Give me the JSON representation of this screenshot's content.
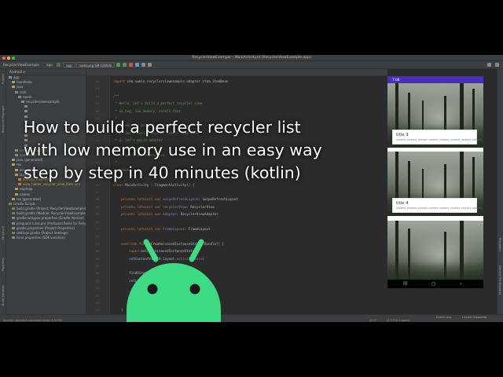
{
  "window": {
    "title": "RecyclerViewExample – MainActivity.kt [RecyclerViewExample.app]"
  },
  "toolbar": {
    "breadcrumbs": [
      "RecyclerViewExample",
      "app",
      "src",
      "main",
      "java",
      "com",
      "swein",
      "recyclerviewexample",
      "MainActivity"
    ],
    "run_config": "app",
    "device": "samsung SM-G991N"
  },
  "tabs": [
    {
      "label": "activity_main.xml",
      "active": false
    },
    {
      "label": "build.gradle (:app)",
      "active": false
    },
    {
      "label": "MainActivity.kt",
      "active": true
    },
    {
      "label": "build.gradle",
      "active": false
    },
    {
      "label": "RecyclerView.kt",
      "active": false
    },
    {
      "label": "FooterViewHolder.kt",
      "active": false
    },
    {
      "label": "RecyclerViewAdapter.kt",
      "active": false
    },
    {
      "label": "ItemBean.kt",
      "active": false
    },
    {
      "label": "MainViewModel.kt",
      "active": false
    }
  ],
  "project": {
    "header": "Android",
    "tree": [
      {
        "label": "app",
        "depth": 0,
        "color": "#a9b7c6",
        "icon": "#6897bb"
      },
      {
        "label": "manifests",
        "depth": 1,
        "color": "#a9b7c6",
        "icon": "#b0a060"
      },
      {
        "label": "java",
        "depth": 1,
        "color": "#a9b7c6",
        "icon": "#b0a060"
      },
      {
        "label": "com",
        "depth": 2,
        "color": "#a9b7c6",
        "icon": "#8a8a8a"
      },
      {
        "label": "swein",
        "depth": 3,
        "color": "#a9b7c6",
        "icon": "#8a8a8a"
      },
      {
        "label": "recyclerviewexample",
        "depth": 4,
        "color": "#a9b7c6",
        "icon": "#8a8a8a"
      },
      {
        "label": "",
        "depth": 5,
        "color": "#a9b7c6",
        "icon": "#8a8a8a"
      },
      {
        "label": "",
        "depth": 5,
        "color": "#a9b7c6",
        "icon": "#8a8a8a"
      },
      {
        "label": "",
        "depth": 5,
        "color": "#a9b7c6",
        "icon": "#8a8a8a"
      },
      {
        "label": "",
        "depth": 5,
        "color": "#a9b7c6",
        "icon": "#8a8a8a"
      },
      {
        "label": "",
        "depth": 5,
        "color": "#a9b7c6",
        "icon": "#8a8a8a"
      },
      {
        "label": "",
        "depth": 5,
        "color": "#a9b7c6",
        "icon": "#8a8a8a"
      },
      {
        "label": "",
        "depth": 5,
        "color": "#a9b7c6",
        "icon": "#8a8a8a"
      },
      {
        "label": "",
        "depth": 5,
        "color": "#a9b7c6",
        "icon": "#8a8a8a"
      },
      {
        "label": "",
        "depth": 5,
        "color": "#a9b7c6",
        "icon": "#8a8a8a"
      },
      {
        "label": "com (androidTest)",
        "depth": 2,
        "color": "#8aa06a",
        "icon": "#8a8a8a"
      },
      {
        "label": "com (test)",
        "depth": 2,
        "color": "#8aa06a",
        "icon": "#8a8a8a"
      },
      {
        "label": "java (generated)",
        "depth": 1,
        "color": "#a9b7c6",
        "icon": "#b0a060"
      },
      {
        "label": "res",
        "depth": 1,
        "color": "#a9b7c6",
        "icon": "#b0a060"
      },
      {
        "label": "drawable",
        "depth": 2,
        "color": "#a9b7c6",
        "icon": "#b0a060"
      },
      {
        "label": "layout",
        "depth": 2,
        "color": "#a9b7c6",
        "icon": "#b0a060"
      },
      {
        "label": "activity_main.xml",
        "depth": 3,
        "color": "#d0a040",
        "icon": "#cc7832"
      },
      {
        "label": "view_holder_recycler_view_item.xml",
        "depth": 3,
        "color": "#d0a040",
        "icon": "#cc7832"
      },
      {
        "label": "mipmap",
        "depth": 2,
        "color": "#a9b7c6",
        "icon": "#b0a060"
      },
      {
        "label": "values",
        "depth": 2,
        "color": "#a9b7c6",
        "icon": "#b0a060"
      },
      {
        "label": "res (generated)",
        "depth": 1,
        "color": "#a9b7c6",
        "icon": "#b0a060"
      },
      {
        "label": "Gradle Scripts",
        "depth": 0,
        "color": "#a9b7c6",
        "icon": "#6a8a5a"
      },
      {
        "label": "build.gradle (Project: RecyclerViewExample)",
        "depth": 1,
        "color": "#a9b7c6",
        "icon": "#6a8a5a"
      },
      {
        "label": "build.gradle (Module: RecyclerViewExample.app)",
        "depth": 1,
        "color": "#a9b7c6",
        "icon": "#6a8a5a"
      },
      {
        "label": "gradle-wrapper.properties (Gradle Version)",
        "depth": 1,
        "color": "#a9b7c6",
        "icon": "#8a8a8a"
      },
      {
        "label": "proguard-rules.pro (ProGuard Rules for RecyclerViewExample.app)",
        "depth": 1,
        "color": "#a9b7c6",
        "icon": "#8a8a8a"
      },
      {
        "label": "gradle.properties (Project Properties)",
        "depth": 1,
        "color": "#a9b7c6",
        "icon": "#8a8a8a"
      },
      {
        "label": "settings.gradle (Project Settings)",
        "depth": 1,
        "color": "#a9b7c6",
        "icon": "#6a8a5a"
      },
      {
        "label": "local.properties (SDK Location)",
        "depth": 1,
        "color": "#a9b7c6",
        "icon": "#8a8a8a"
      }
    ]
  },
  "left_strip": [
    "Project",
    "Resource Manager",
    "Structure",
    "Favorites",
    "Build Variants"
  ],
  "right_strip": [
    "Emulator",
    "Device File Explorer"
  ],
  "editor": {
    "line_numbers": [
      "12",
      "13",
      "14",
      "15",
      "16",
      "17",
      "18",
      "19",
      "20",
      "21",
      "22",
      "23",
      "24",
      "25",
      "26",
      "27",
      "28",
      "29",
      "30",
      "31",
      "32",
      "33",
      "34",
      "35",
      "36",
      "37",
      "38",
      "39",
      "40",
      "41",
      "42",
      "43"
    ],
    "lines": [
      [
        {
          "t": "import ",
          "c": "kw"
        },
        {
          "t": "com.swein.recyclerviewexample.adapter.item.ItemBean",
          "c": ""
        }
      ],
      [
        {
          "t": "",
          "c": ""
        }
      ],
      [
        {
          "t": "/**",
          "c": "cm"
        }
      ],
      [
        {
          "t": " * Hello, let's build a perfect recycler view",
          "c": "cm"
        }
      ],
      [
        {
          "t": " * no bug, low memory, scroll fast",
          "c": "cm"
        }
      ],
      [
        {
          "t": " *",
          "c": "cm"
        }
      ],
      [
        {
          "t": " * 1. xml and project setting",
          "c": "cm"
        }
      ],
      [
        {
          "t": " * 2. let's build recycler view's item view",
          "c": "cm"
        }
      ],
      [
        {
          "t": " * 3. let's build adapter",
          "c": "cm"
        }
      ],
      [
        {
          "t": " * 4. let's use it",
          "c": "cm"
        }
      ],
      [
        {
          "t": " * 5. let's add a progress",
          "c": "cm"
        }
      ],
      [
        {
          "t": " *",
          "c": "cm"
        }
      ],
      [
        {
          "t": " * thanks",
          "c": "cm"
        }
      ],
      [
        {
          "t": " */",
          "c": "cm"
        }
      ],
      [
        {
          "t": "class ",
          "c": "kw"
        },
        {
          "t": "MainActivity : FragmentActivity() {",
          "c": ""
        }
      ],
      [
        {
          "t": "",
          "c": ""
        }
      ],
      [
        {
          "t": "    private lateinit var ",
          "c": "kw"
        },
        {
          "t": "swipeRefreshLayout",
          "c": "pr"
        },
        {
          "t": ": SwipeRefreshLayout",
          "c": ""
        }
      ],
      [
        {
          "t": "    private lateinit var ",
          "c": "kw"
        },
        {
          "t": "recyclerView",
          "c": "pr"
        },
        {
          "t": ": RecyclerView",
          "c": ""
        }
      ],
      [
        {
          "t": "    private lateinit var ",
          "c": "kw"
        },
        {
          "t": "adapter",
          "c": "pr"
        },
        {
          "t": ": RecyclerViewAdapter",
          "c": ""
        }
      ],
      [
        {
          "t": "",
          "c": ""
        }
      ],
      [
        {
          "t": "    private lateinit var ",
          "c": "kw"
        },
        {
          "t": "frameLayout",
          "c": "pr"
        },
        {
          "t": ": FrameLayout",
          "c": ""
        }
      ],
      [
        {
          "t": "",
          "c": ""
        }
      ],
      [
        {
          "t": "    override fun ",
          "c": "kw"
        },
        {
          "t": "onCreate",
          "c": "fn"
        },
        {
          "t": "(savedInstanceState: Bundle?) {",
          "c": ""
        }
      ],
      [
        {
          "t": "        super",
          "c": "kw"
        },
        {
          "t": ".onCreate(savedInstanceState)",
          "c": ""
        }
      ],
      [
        {
          "t": "        setContentView(R.layout.",
          "c": ""
        },
        {
          "t": "activity_main",
          "c": "pr"
        },
        {
          "t": ")",
          "c": ""
        }
      ],
      [
        {
          "t": "",
          "c": ""
        }
      ],
      [
        {
          "t": "        findView()",
          "c": ""
        }
      ],
      [
        {
          "t": "        setListener()",
          "c": ""
        }
      ],
      [
        {
          "t": "",
          "c": ""
        }
      ],
      [
        {
          "t": "        initList()",
          "c": ""
        }
      ],
      [
        {
          "t": "        reload()",
          "c": ""
        }
      ],
      [
        {
          "t": "    }",
          "c": ""
        }
      ]
    ]
  },
  "emulator": {
    "time": "7:08",
    "cards": [
      {
        "title": "title 3",
        "body": "content_content_content_content_content_content_content_content_3"
      },
      {
        "title": "title 4",
        "body": "content_content_content_content_content_content_content_content_4"
      }
    ],
    "nav": [
      "|||",
      "○",
      "‹"
    ]
  },
  "bottom_bar": {
    "items": [
      "TODO",
      "Problems",
      "Terminal",
      "Logcat",
      "Profiler",
      "Database Inspector",
      "Run"
    ],
    "right_items": [
      "Event Log",
      "Layout Inspector"
    ]
  },
  "status_bar": {
    "message": "Success: Operation succeeded (today 5:31 PM)",
    "position": "41:17",
    "encoding": "LF  UTF-8  4 spaces"
  },
  "overlay": {
    "lines": [
      "How to build a perfect recycler list",
      "with low memory use in an easy way",
      "step by step in 40 minutes (kotlin)"
    ]
  },
  "colors": {
    "android_green": "#3ddc84",
    "ide_background": "#2b2b2b",
    "emulator_status": "#4a2fbf"
  }
}
